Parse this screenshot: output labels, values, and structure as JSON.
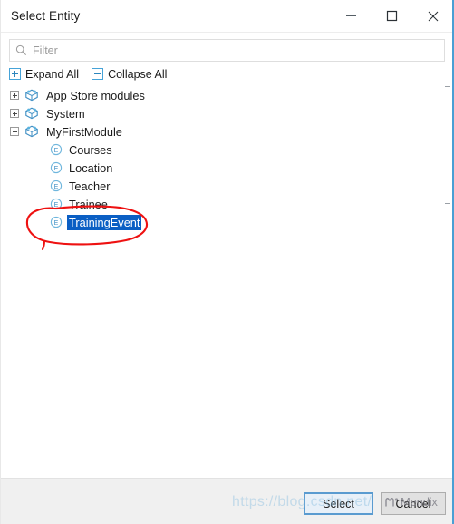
{
  "window": {
    "title": "Select Entity",
    "controls": [
      {
        "name": "minimize",
        "glyph": "minimize-icon"
      },
      {
        "name": "maximize",
        "glyph": "maximize-icon"
      },
      {
        "name": "close",
        "glyph": "close-icon"
      }
    ]
  },
  "filter": {
    "value": "",
    "placeholder": "Filter",
    "icon": "search-icon"
  },
  "toolbar": {
    "expand_all_label": "Expand All",
    "collapse_all_label": "Collapse All"
  },
  "tree": {
    "nodes": [
      {
        "label": "App Store modules",
        "type": "module",
        "state": "collapsed",
        "level": 0,
        "selected": false
      },
      {
        "label": "System",
        "type": "module",
        "state": "collapsed",
        "level": 0,
        "selected": false
      },
      {
        "label": "MyFirstModule",
        "type": "module",
        "state": "expanded",
        "level": 0,
        "selected": false
      },
      {
        "label": "Courses",
        "type": "entity",
        "state": "leaf",
        "level": 1,
        "selected": false
      },
      {
        "label": "Location",
        "type": "entity",
        "state": "leaf",
        "level": 1,
        "selected": false
      },
      {
        "label": "Teacher",
        "type": "entity",
        "state": "leaf",
        "level": 1,
        "selected": false
      },
      {
        "label": "Trainee",
        "type": "entity",
        "state": "leaf",
        "level": 1,
        "selected": false
      },
      {
        "label": "TrainingEvent",
        "type": "entity",
        "state": "leaf",
        "level": 1,
        "selected": true
      }
    ],
    "entity_icon_letter": "E"
  },
  "footer": {
    "select_label": "Select",
    "cancel_label": "Cancel"
  },
  "annotation": {
    "shape": "red-ellipse-highlight",
    "target": "TrainingEvent",
    "color": "#ee1111"
  },
  "watermarks": {
    "url_text": "https://blog.csdn.net/",
    "brand_text": "Mendix"
  },
  "colors": {
    "selection_blue": "#0b5fc4",
    "accent_border": "#4a9fd4",
    "annotation_red": "#ee1111",
    "icon_blue": "#46a3d8",
    "footer_bg": "#f0f0f0"
  }
}
